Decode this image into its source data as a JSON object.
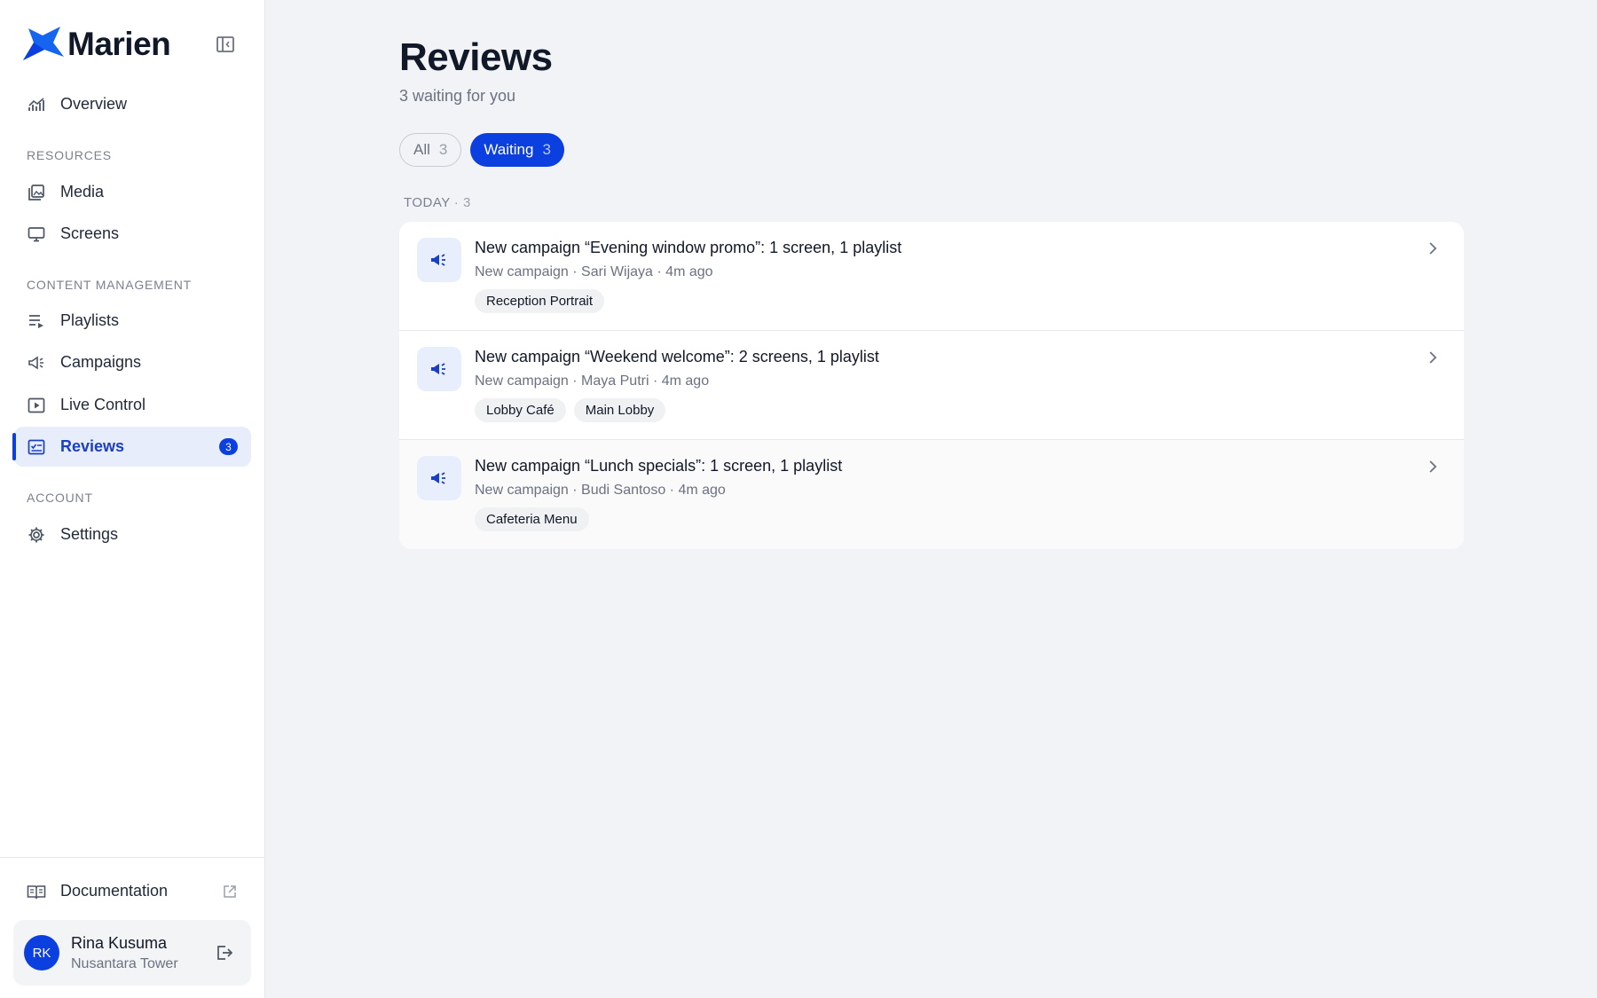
{
  "brand": {
    "name": "Marien",
    "logo_icon": "star-logo-icon",
    "accent": "#0b3fe0"
  },
  "sidebar": {
    "overview": {
      "label": "Overview",
      "icon": "chart-line-icon"
    },
    "sections": {
      "resources": "RESOURCES",
      "content_management": "CONTENT MANAGEMENT",
      "account": "ACCOUNT"
    },
    "items": [
      {
        "label": "Media",
        "icon": "image-stack-icon"
      },
      {
        "label": "Screens",
        "icon": "monitor-icon"
      },
      {
        "label": "Playlists",
        "icon": "playlist-icon"
      },
      {
        "label": "Campaigns",
        "icon": "megaphone-icon"
      },
      {
        "label": "Live Control",
        "icon": "play-screen-icon"
      },
      {
        "label": "Reviews",
        "icon": "review-icon",
        "badge": "3",
        "active": true
      },
      {
        "label": "Settings",
        "icon": "gear-icon"
      }
    ],
    "documentation": {
      "label": "Documentation",
      "icon": "book-icon",
      "ext_icon": "external-link-icon"
    },
    "user": {
      "initials": "RK",
      "name": "Rina Kusuma",
      "org": "Nusantara Tower"
    }
  },
  "main": {
    "title": "Reviews",
    "subtitle": "3 waiting for you",
    "filters": [
      {
        "label": "All",
        "count": "3",
        "selected": false
      },
      {
        "label": "Waiting",
        "count": "3",
        "selected": true
      }
    ],
    "group": {
      "label": "TODAY",
      "count": "· 3"
    },
    "rows": [
      {
        "title": "New campaign “Evening window promo”: 1 screen, 1 playlist",
        "meta": "New campaign · Sari Wijaya · 4m ago",
        "tags": [
          "Reception Portrait"
        ]
      },
      {
        "title": "New campaign “Weekend welcome”: 2 screens, 1 playlist",
        "meta": "New campaign · Maya Putri · 4m ago",
        "tags": [
          "Lobby Café",
          "Main Lobby"
        ]
      },
      {
        "title": "New campaign “Lunch specials”: 1 screen, 1 playlist",
        "meta": "New campaign · Budi Santoso · 4m ago",
        "tags": [
          "Cafeteria Menu"
        ]
      }
    ]
  }
}
